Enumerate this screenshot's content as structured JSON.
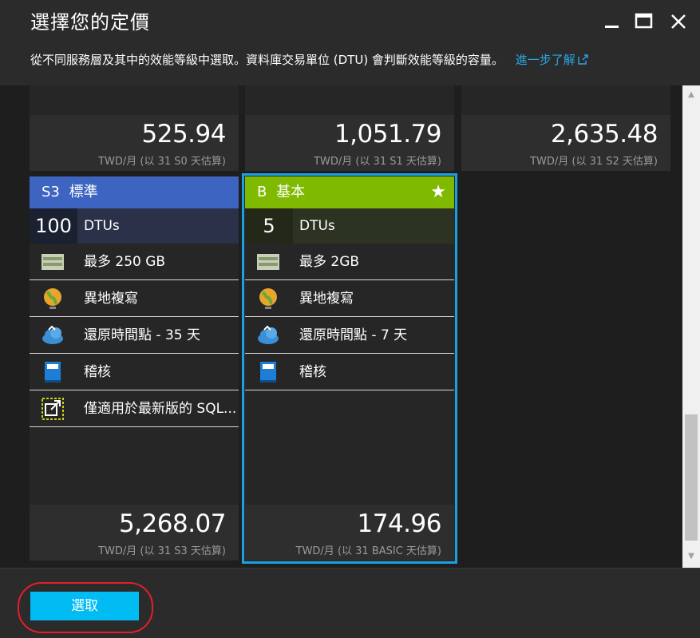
{
  "header": {
    "title": "選擇您的定價",
    "subtitle": "從不同服務層及其中的效能等級中選取。資料庫交易單位 (DTU) 會判斷效能等級的容量。",
    "learn_more": "進一步了解"
  },
  "top_prices": [
    {
      "price": "525.94",
      "sub": "TWD/月 (以 31 S0 天估算)"
    },
    {
      "price": "1,051.79",
      "sub": "TWD/月 (以 31 S1 天估算)"
    },
    {
      "price": "2,635.48",
      "sub": "TWD/月 (以 31 S2 天估算)"
    }
  ],
  "cards": [
    {
      "tier": "S3",
      "name": "標準",
      "dtu_value": "100",
      "dtu_label": "DTUs",
      "features": [
        {
          "icon": "storage-icon",
          "text": "最多 250 GB"
        },
        {
          "icon": "globe-icon",
          "text": "異地複寫"
        },
        {
          "icon": "cloud-restore-icon",
          "text": "還原時間點 - 35 天"
        },
        {
          "icon": "audit-book-icon",
          "text": "稽核"
        },
        {
          "icon": "external-link-icon",
          "text": "僅適用於最新版的 SQL..."
        }
      ],
      "price": "5,268.07",
      "price_sub": "TWD/月 (以 31 S3 天估算)",
      "header_color": "#3c64c0",
      "selected": false
    },
    {
      "tier": "B",
      "name": "基本",
      "dtu_value": "5",
      "dtu_label": "DTUs",
      "star": "★",
      "features": [
        {
          "icon": "storage-icon",
          "text": "最多 2GB"
        },
        {
          "icon": "globe-icon",
          "text": "異地複寫"
        },
        {
          "icon": "cloud-restore-icon",
          "text": "還原時間點 - 7 天"
        },
        {
          "icon": "audit-book-icon",
          "text": "稽核"
        }
      ],
      "price": "174.96",
      "price_sub": "TWD/月 (以 31 BASIC 天估算)",
      "header_color": "#7fba00",
      "selected": true
    }
  ],
  "footer": {
    "select_label": "選取"
  },
  "colors": {
    "accent": "#00bcf2",
    "selected_border": "#1ba1e2",
    "highlight": "#e0202a"
  }
}
